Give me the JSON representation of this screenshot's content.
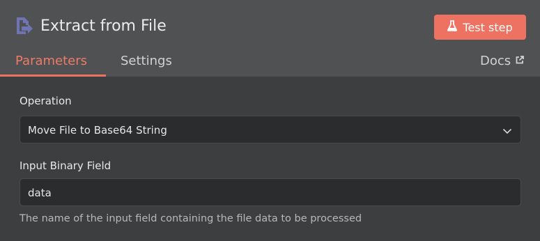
{
  "node": {
    "title": "Extract from File",
    "icon": "file-extract-icon",
    "icon_color": "#6f74b4"
  },
  "header": {
    "test_button_label": "Test step",
    "test_button_icon": "flask-icon",
    "accent_color": "#ed7261"
  },
  "tabs": {
    "parameters": "Parameters",
    "settings": "Settings",
    "docs": "Docs",
    "docs_icon": "external-link-icon",
    "active": "Parameters"
  },
  "fields": {
    "operation": {
      "label": "Operation",
      "value": "Move File to Base64 String"
    },
    "input_binary_field": {
      "label": "Input Binary Field",
      "value": "data",
      "hint": "The name of the input field containing the file data to be processed"
    }
  }
}
